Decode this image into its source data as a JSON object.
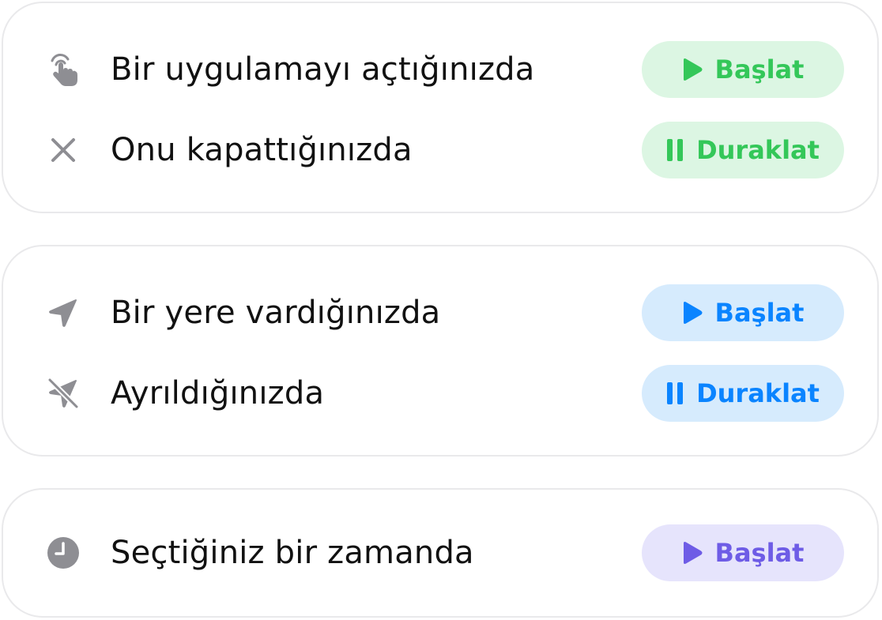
{
  "groups": [
    {
      "color": "#34c759",
      "rows": [
        {
          "icon": "hand-tap-icon",
          "label": "Bir uygulamayı açtığınızda",
          "action": "Başlat",
          "action_icon": "play-icon"
        },
        {
          "icon": "close-icon",
          "label": "Onu kapattığınızda",
          "action": "Duraklat",
          "action_icon": "pause-icon"
        }
      ]
    },
    {
      "color": "#0a84ff",
      "rows": [
        {
          "icon": "location-arrow-icon",
          "label": "Bir yere vardığınızda",
          "action": "Başlat",
          "action_icon": "play-icon"
        },
        {
          "icon": "location-off-icon",
          "label": "Ayrıldığınızda",
          "action": "Duraklat",
          "action_icon": "pause-icon"
        }
      ]
    },
    {
      "color": "#6e5ce6",
      "rows": [
        {
          "icon": "clock-icon",
          "label": "Seçtiğiniz bir zamanda",
          "action": "Başlat",
          "action_icon": "play-icon"
        }
      ]
    }
  ]
}
